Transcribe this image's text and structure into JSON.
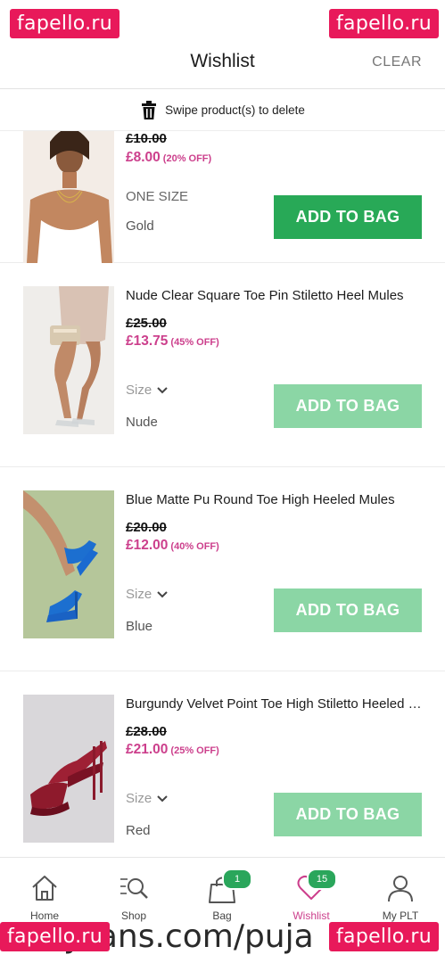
{
  "watermark": {
    "badge": "fapello.ru",
    "bottom_text": "OnlyFans.com/puja"
  },
  "header": {
    "title": "Wishlist",
    "clear": "CLEAR"
  },
  "hint": {
    "text": "Swipe product(s) to delete"
  },
  "items": [
    {
      "name": "",
      "was_price": "£10.00",
      "price": "£8.00",
      "discount": "(20% OFF)",
      "size": "ONE SIZE",
      "color": "Gold",
      "button": "ADD TO BAG",
      "button_enabled": true
    },
    {
      "name": "Nude Clear Square Toe Pin Stiletto Heel Mules",
      "was_price": "£25.00",
      "price": "£13.75",
      "discount": "(45% OFF)",
      "size": "Size",
      "color": "Nude",
      "button": "ADD TO BAG",
      "button_enabled": false
    },
    {
      "name": "Blue Matte Pu Round Toe High Heeled Mules",
      "was_price": "£20.00",
      "price": "£12.00",
      "discount": "(40% OFF)",
      "size": "Size",
      "color": "Blue",
      "button": "ADD TO BAG",
      "button_enabled": false
    },
    {
      "name": "Burgundy Velvet Point Toe High Stiletto Heeled Mules",
      "was_price": "£28.00",
      "price": "£21.00",
      "discount": "(25% OFF)",
      "size": "Size",
      "color": "Red",
      "button": "ADD TO BAG",
      "button_enabled": false
    }
  ],
  "tabs": [
    {
      "label": "Home",
      "icon": "home-icon"
    },
    {
      "label": "Shop",
      "icon": "search-list-icon"
    },
    {
      "label": "Bag",
      "icon": "bag-icon",
      "badge": "1"
    },
    {
      "label": "Wishlist",
      "icon": "heart-icon",
      "badge": "15",
      "selected": true
    },
    {
      "label": "My PLT",
      "icon": "user-icon"
    }
  ],
  "colors": {
    "accent_pink": "#cc3f8c",
    "green": "#28a957",
    "green_disabled": "#8bd6a5",
    "watermark": "#e8195a"
  }
}
